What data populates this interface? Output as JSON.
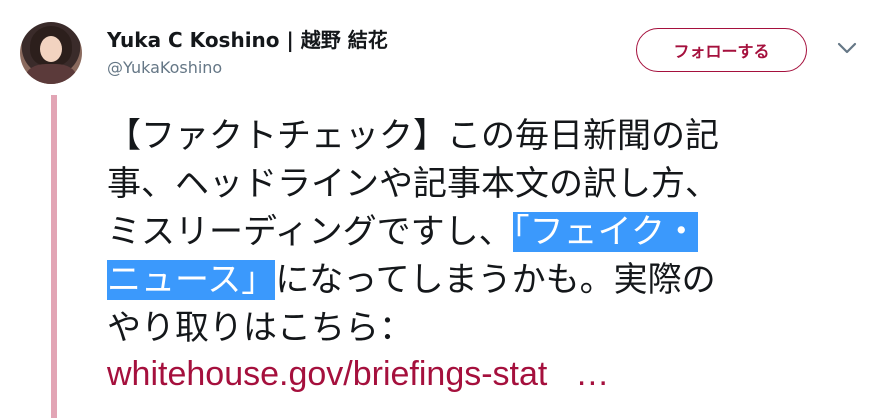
{
  "user": {
    "display_name": "Yuka C Koshino | 越野 結花",
    "handle": "@YukaKoshino"
  },
  "follow_button": {
    "label": "フォローする"
  },
  "menu": {
    "icon": "chevron-down-icon"
  },
  "tweet": {
    "line1": "【ファクトチェック】この毎日新聞の記",
    "line2": "事、ヘッドラインや記事本文の訳し方、",
    "line3_plain": "ミスリーディングですし、",
    "line3_highlight": "「フェイク・",
    "line4_highlight": "ニュース」",
    "line4_plain": "になってしまうかも。実際の",
    "line5": "やり取りはこちら：",
    "link_text": "whitehouse.gov/briefings-stat",
    "link_ellipsis": "…"
  },
  "colors": {
    "accent": "#a5103d",
    "highlight": "#3b99fc",
    "thread_line": "#e2a5b5"
  }
}
